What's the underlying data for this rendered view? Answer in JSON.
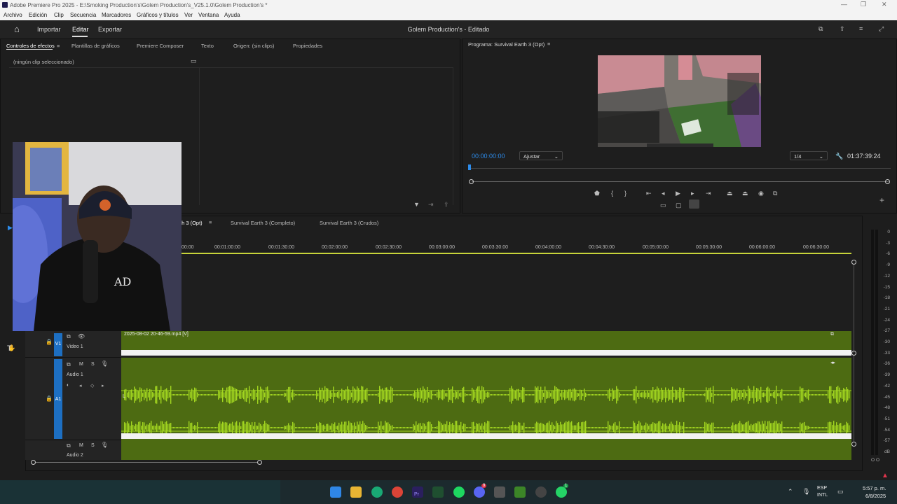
{
  "window": {
    "title": "Adobe Premiere Pro 2025 - E:\\Smoking Production's\\Golem Production's_V25.1.0\\Golem Production's *"
  },
  "menu": [
    "Archivo",
    "Edición",
    "Clip",
    "Secuencia",
    "Marcadores",
    "Gráficos y títulos",
    "Ver",
    "Ventana",
    "Ayuda"
  ],
  "header": {
    "nav": [
      "Importar",
      "Editar",
      "Exportar"
    ],
    "project_title": "Golem Production's - Editado"
  },
  "left_panel": {
    "tabs": [
      "Controles de efectos",
      "Plantillas de gráficos",
      "Premiere Composer",
      "Texto",
      "Origen: (sin clips)",
      "Propiedades"
    ],
    "no_clip": "(ningún clip seleccionado)"
  },
  "program": {
    "title": "Programa: Survival Earth 3 (Opt)",
    "timecode_in": "00:00:00:00",
    "fit": "Ajustar",
    "quality": "1/4",
    "duration": "01:37:39:24"
  },
  "timeline": {
    "tabs": [
      "th 3 (Opt)",
      "Survival Earth 3 (Completo)",
      "Survival Earth 3 (Crudos)"
    ],
    "ruler": [
      "00:00",
      "00:01:00:00",
      "00:01:30:00",
      "00:02:00:00",
      "00:02:30:00",
      "00:03:00:00",
      "00:03:30:00",
      "00:04:00:00",
      "00:04:30:00",
      "00:05:00:00",
      "00:05:30:00",
      "00:06:00:00",
      "00:06:30:00"
    ],
    "tracks": {
      "v1": {
        "id": "V1",
        "name": "Video 1",
        "clip": "2025-08-02 20-46-59.mp4 [V]"
      },
      "a1": {
        "id": "A1",
        "name": "Audio 1"
      },
      "a2": {
        "name": "Audio 2"
      }
    },
    "mute": "M",
    "solo": "S"
  },
  "meter": {
    "scale": [
      "0",
      "-3",
      "-6",
      "-9",
      "-12",
      "-15",
      "-18",
      "-21",
      "-24",
      "-27",
      "-30",
      "-33",
      "-36",
      "-39",
      "-42",
      "-45",
      "-48",
      "-51",
      "-54",
      "-57",
      "dB"
    ],
    "footer": [
      "O",
      "O"
    ]
  },
  "taskbar": {
    "lang1": "ESP",
    "lang2": "INTL",
    "time": "5:57 p. m.",
    "date": "6/8/2025",
    "badges": {
      "discord": "9",
      "whatsapp": "1",
      "chrome": "7"
    }
  },
  "colors": {
    "accent": "#2d8ceb",
    "track_blue": "#1d6fc2",
    "clip_green": "#4d6b12",
    "wave": "#a2d620",
    "playhead": "#c8d43a"
  }
}
